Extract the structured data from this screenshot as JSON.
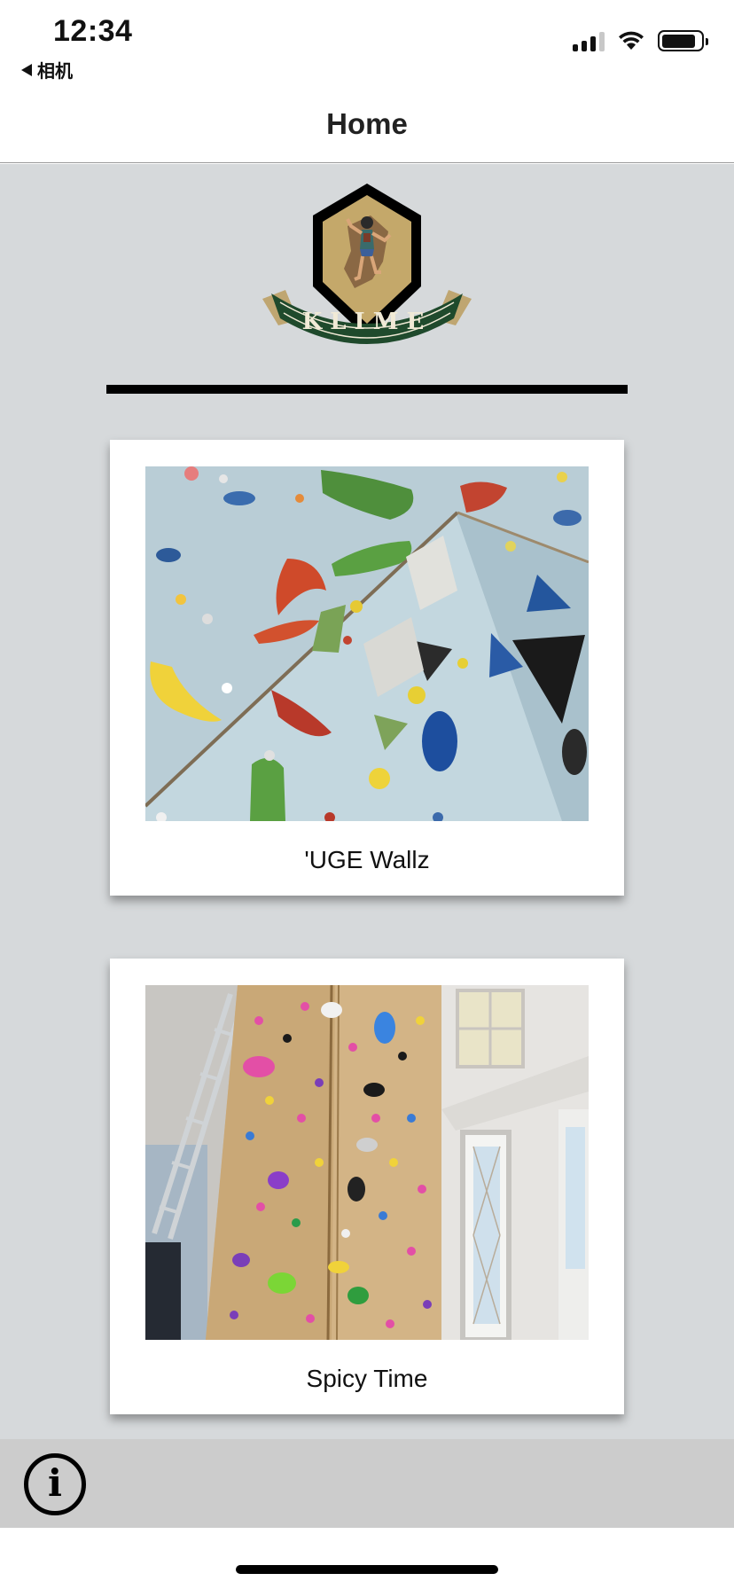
{
  "status_bar": {
    "time": "12:34",
    "back_app_label": "相机",
    "back_icon": "back-triangle-icon",
    "signal_icon": "cellular-signal-icon",
    "wifi_icon": "wifi-icon",
    "battery_icon": "battery-icon"
  },
  "nav": {
    "title": "Home"
  },
  "logo": {
    "text": "KLIME",
    "icon": "klime-climber-badge-logo",
    "colors": {
      "hexagon": "#000000",
      "inner": "#c4a86a",
      "banner": "#1f4a2c",
      "banner_tail": "#bfa671",
      "text": "#f1ead6"
    }
  },
  "walls": [
    {
      "title": "'UGE Wallz",
      "image": "climbing-wall-photo-blue-holds"
    },
    {
      "title": "Spicy Time",
      "image": "climbing-wall-photo-plywood-home"
    }
  ],
  "toolbar": {
    "info_icon": "info-icon"
  },
  "colors": {
    "content_bg": "#d6d9db",
    "toolbar_bg": "#cccccc",
    "card_bg": "#ffffff"
  }
}
